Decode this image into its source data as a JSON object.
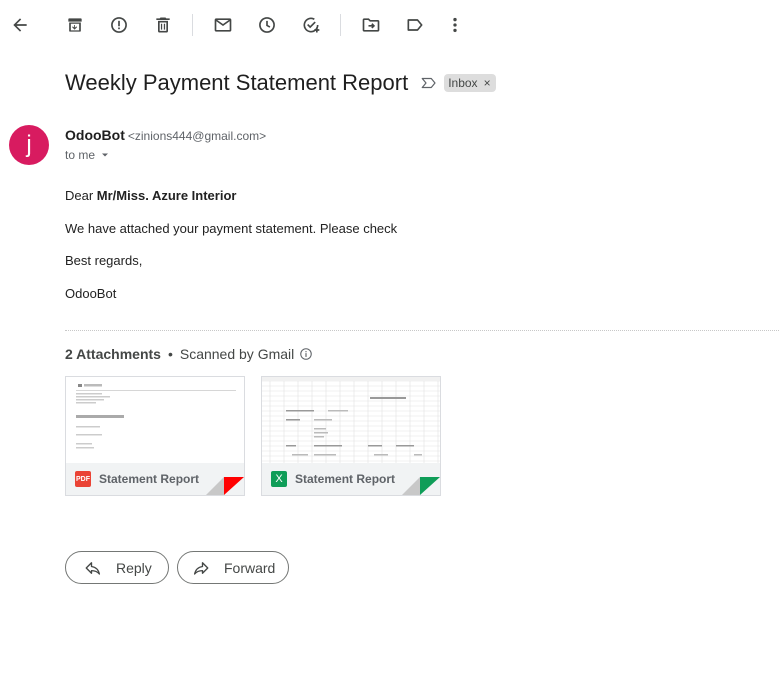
{
  "toolbar": {
    "icons": [
      "back-arrow-icon",
      "archive-icon",
      "report-spam-icon",
      "delete-icon",
      "mark-unread-icon",
      "snooze-icon",
      "add-task-icon",
      "move-to-icon",
      "label-icon",
      "more-vert-icon"
    ]
  },
  "email": {
    "subject": "Weekly Payment Statement Report",
    "label_chip": "Inbox",
    "label_remove": "×",
    "sender": {
      "avatar_letter": "j",
      "avatar_color": "#d81b60",
      "name": "OdooBot",
      "email": "<zinions444@gmail.com>"
    },
    "recipient": "to me",
    "body": {
      "greeting_prefix": "Dear ",
      "greeting_name": "Mr/Miss. Azure Interior",
      "line1": "We have attached your payment statement. Please check",
      "line2": "Best regards,",
      "signature": "OdooBot"
    }
  },
  "attachments": {
    "count_label": "2 Attachments",
    "separator": "•",
    "scanned_label": "Scanned by Gmail",
    "items": [
      {
        "name": "Statement Report",
        "type": "pdf",
        "type_label": "PDF",
        "accent": "#ff0000"
      },
      {
        "name": "Statement Report",
        "type": "xls",
        "type_label": "X",
        "accent": "#0f9d58"
      }
    ]
  },
  "actions": {
    "reply_label": "Reply",
    "forward_label": "Forward"
  }
}
